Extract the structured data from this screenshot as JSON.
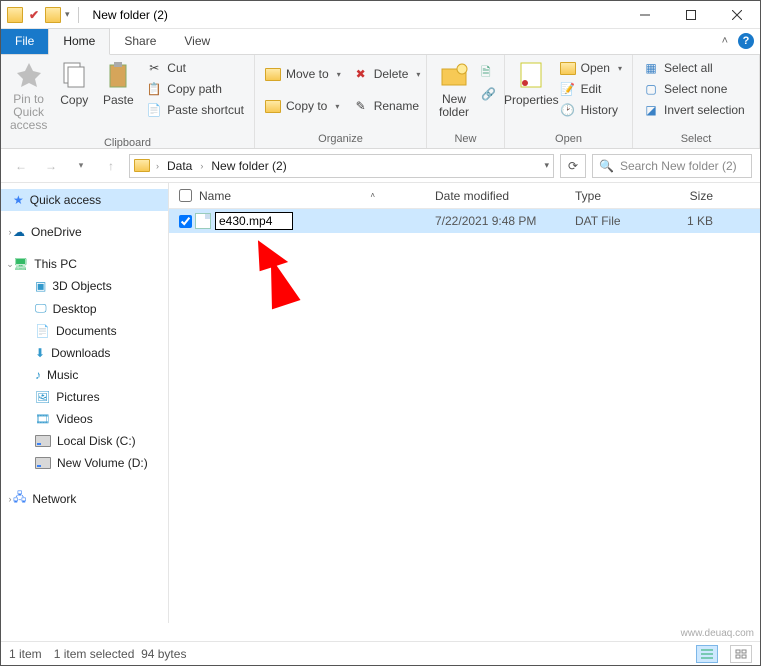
{
  "title": "New folder (2)",
  "tabs": {
    "file": "File",
    "home": "Home",
    "share": "Share",
    "view": "View"
  },
  "ribbon": {
    "clipboard": {
      "label": "Clipboard",
      "pin": "Pin to Quick access",
      "copy": "Copy",
      "paste": "Paste",
      "cut": "Cut",
      "copypath": "Copy path",
      "pasteshort": "Paste shortcut"
    },
    "organize": {
      "label": "Organize",
      "moveto": "Move to",
      "copyto": "Copy to",
      "delete": "Delete",
      "rename": "Rename"
    },
    "new": {
      "label": "New",
      "newfolder": "New folder"
    },
    "open": {
      "label": "Open",
      "properties": "Properties",
      "open": "Open",
      "edit": "Edit",
      "history": "History"
    },
    "select": {
      "label": "Select",
      "all": "Select all",
      "none": "Select none",
      "invert": "Invert selection"
    }
  },
  "breadcrumbs": [
    "Data",
    "New folder (2)"
  ],
  "search_placeholder": "Search New folder (2)",
  "nav": {
    "quick": "Quick access",
    "onedrive": "OneDrive",
    "thispc": "This PC",
    "children": [
      "3D Objects",
      "Desktop",
      "Documents",
      "Downloads",
      "Music",
      "Pictures",
      "Videos",
      "Local Disk (C:)",
      "New Volume (D:)"
    ],
    "network": "Network"
  },
  "columns": {
    "name": "Name",
    "date": "Date modified",
    "type": "Type",
    "size": "Size"
  },
  "file": {
    "rename_value": "e430.mp4",
    "date": "7/22/2021 9:48 PM",
    "type": "DAT File",
    "size": "1 KB"
  },
  "status": {
    "count": "1 item",
    "selected": "1 item selected",
    "bytes": "94 bytes"
  },
  "watermark": "www.deuaq.com"
}
